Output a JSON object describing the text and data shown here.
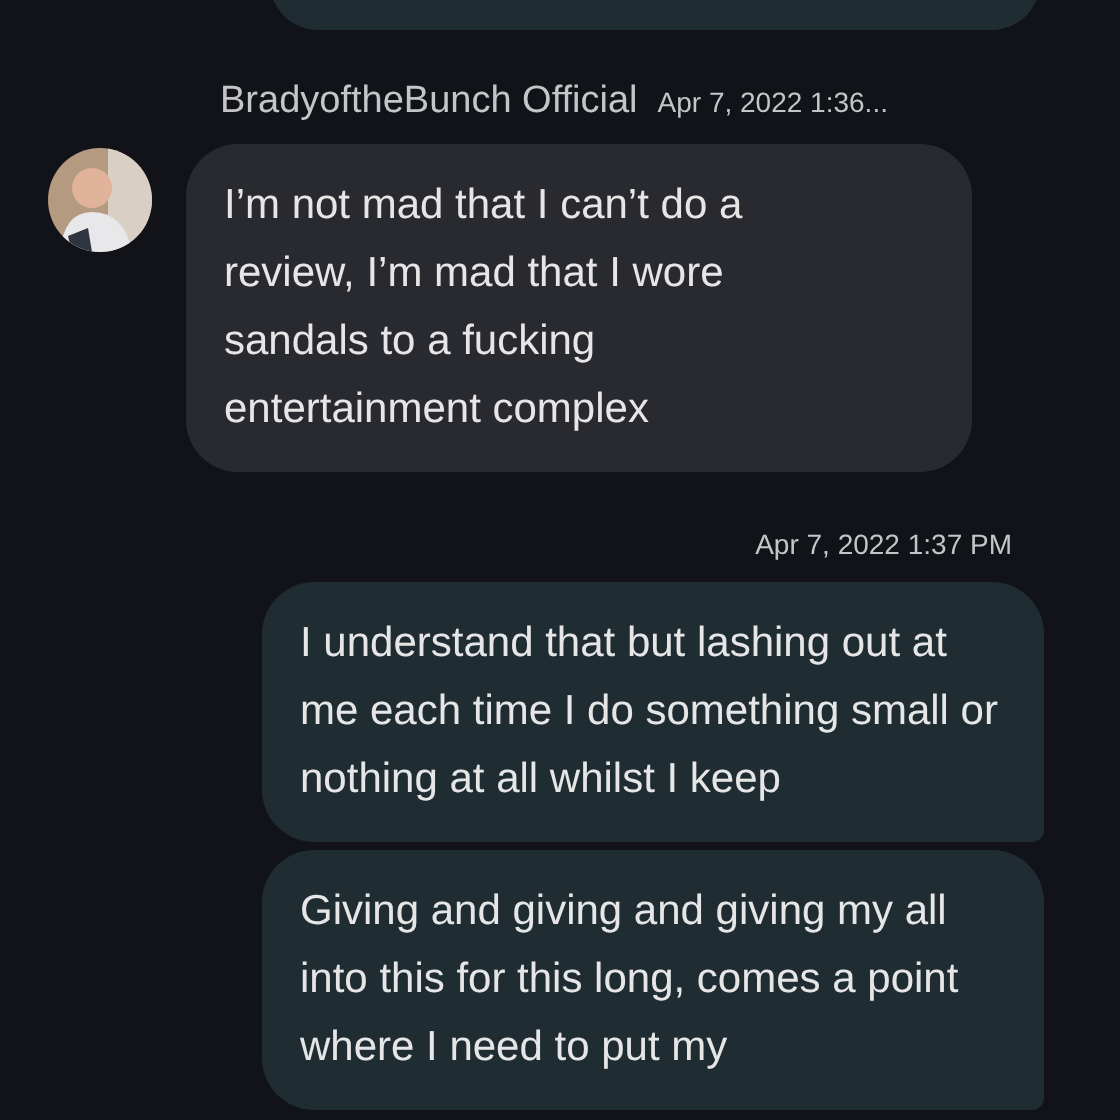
{
  "messages": [
    {
      "kind": "sent_partial"
    },
    {
      "kind": "received",
      "sender": "BradyoftheBunch Official",
      "time": "Apr 7, 2022 1:36...",
      "text": "I’m not mad that I can’t do a review, I’m mad that I wore sandals to a fucking entertainment complex"
    },
    {
      "kind": "sent",
      "time": "Apr 7, 2022 1:37 PM",
      "text": "I understand that but lashing out at me each time I do something small or nothing at all whilst I keep"
    },
    {
      "kind": "sent",
      "text": "Giving and giving and giving my all into this for this long, comes a point where I need to put my"
    }
  ]
}
